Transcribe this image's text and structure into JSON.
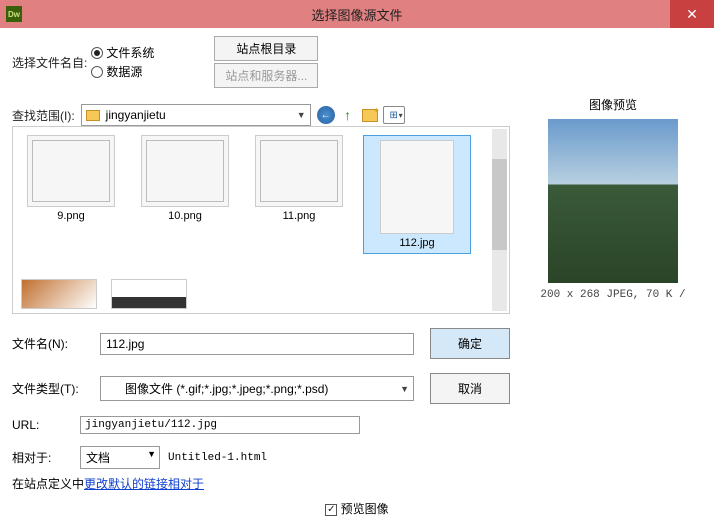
{
  "titlebar": {
    "app": "Dw",
    "title": "选择图像源文件",
    "close": "✕"
  },
  "source": {
    "label": "选择文件名自:",
    "opt1": "文件系统",
    "opt2": "数据源",
    "btn1": "站点根目录",
    "btn2": "站点和服务器..."
  },
  "lookup": {
    "label": "查找范围(I):",
    "folder": "jingyanjietu"
  },
  "files": {
    "f1": "9.png",
    "f2": "10.png",
    "f3": "11.png",
    "f4": "112.jpg"
  },
  "form": {
    "filename_label": "文件名(N):",
    "filename_value": "112.jpg",
    "filetype_label": "文件类型(T):",
    "filetype_value": "图像文件 (*.gif;*.jpg;*.jpeg;*.png;*.psd)",
    "ok": "确定",
    "cancel": "取消"
  },
  "url": {
    "label": "URL:",
    "value": "jingyanjietu/112.jpg",
    "rel_label": "相对于:",
    "rel_value": "文档",
    "rel_file": "Untitled-1.html",
    "note_prefix": "在站点定义中",
    "note_link": "更改默认的链接相对于"
  },
  "preview": {
    "title": "图像预览",
    "info": "200 x 268 JPEG, 70 K /",
    "checkbox": "预览图像"
  }
}
